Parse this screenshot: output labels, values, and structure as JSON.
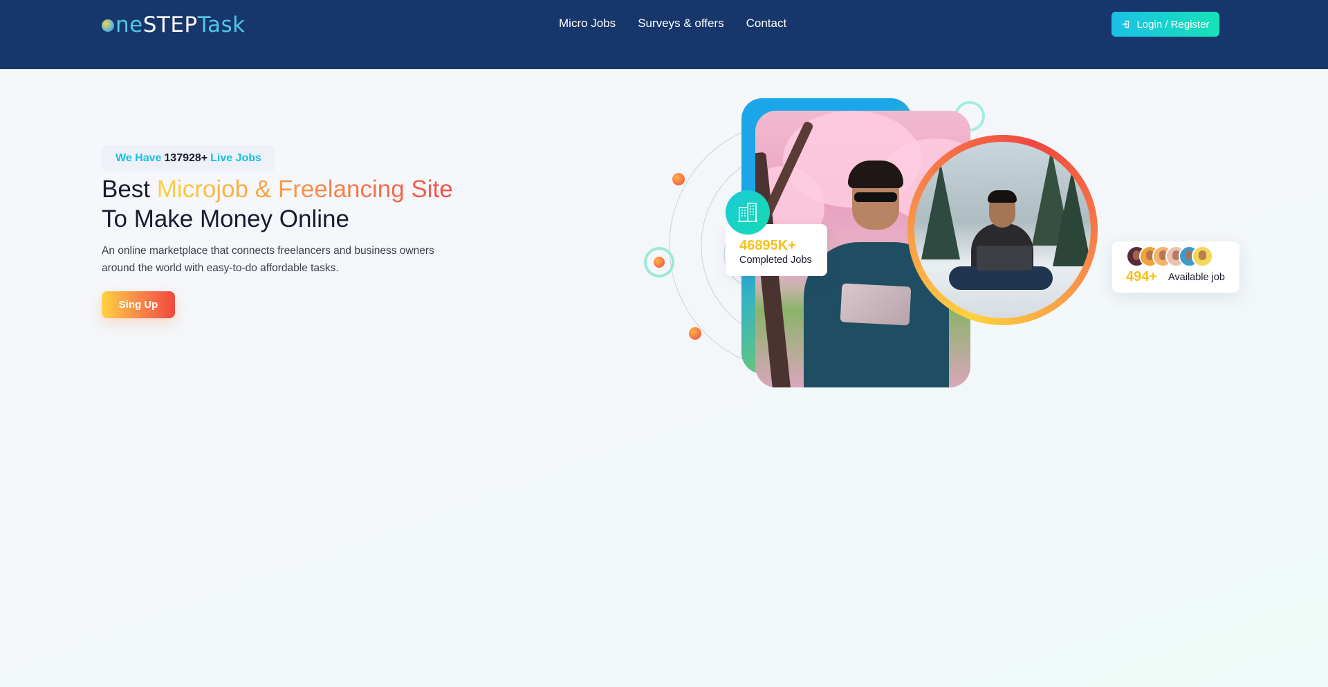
{
  "header": {
    "logo": {
      "part1": "ne",
      "part2": "STEP",
      "part3": "Task"
    },
    "nav": [
      {
        "label": "Micro Jobs"
      },
      {
        "label": "Surveys & offers"
      },
      {
        "label": "Contact"
      }
    ],
    "login_label": "Login / Register"
  },
  "hero": {
    "badge": {
      "prefix": "We Have",
      "count": "137928+",
      "suffix": "Live Jobs"
    },
    "title": {
      "line1_plain": "Best",
      "line1_highlight": "Microjob & Freelancing Site",
      "line2": "To Make Money Online"
    },
    "description": "An online marketplace that connects freelancers and business owners around the world with easy-to-do affordable tasks.",
    "signup_label": "Sing Up"
  },
  "stats": {
    "completed": {
      "value": "46895K+",
      "label": "Completed Jobs"
    },
    "available": {
      "value": "494+",
      "label": "Available job"
    }
  },
  "colors": {
    "header_bg": "#17366b",
    "accent_teal": "#16bfe0",
    "accent_orange": "#f7894a",
    "accent_yellow": "#f5c21b"
  }
}
